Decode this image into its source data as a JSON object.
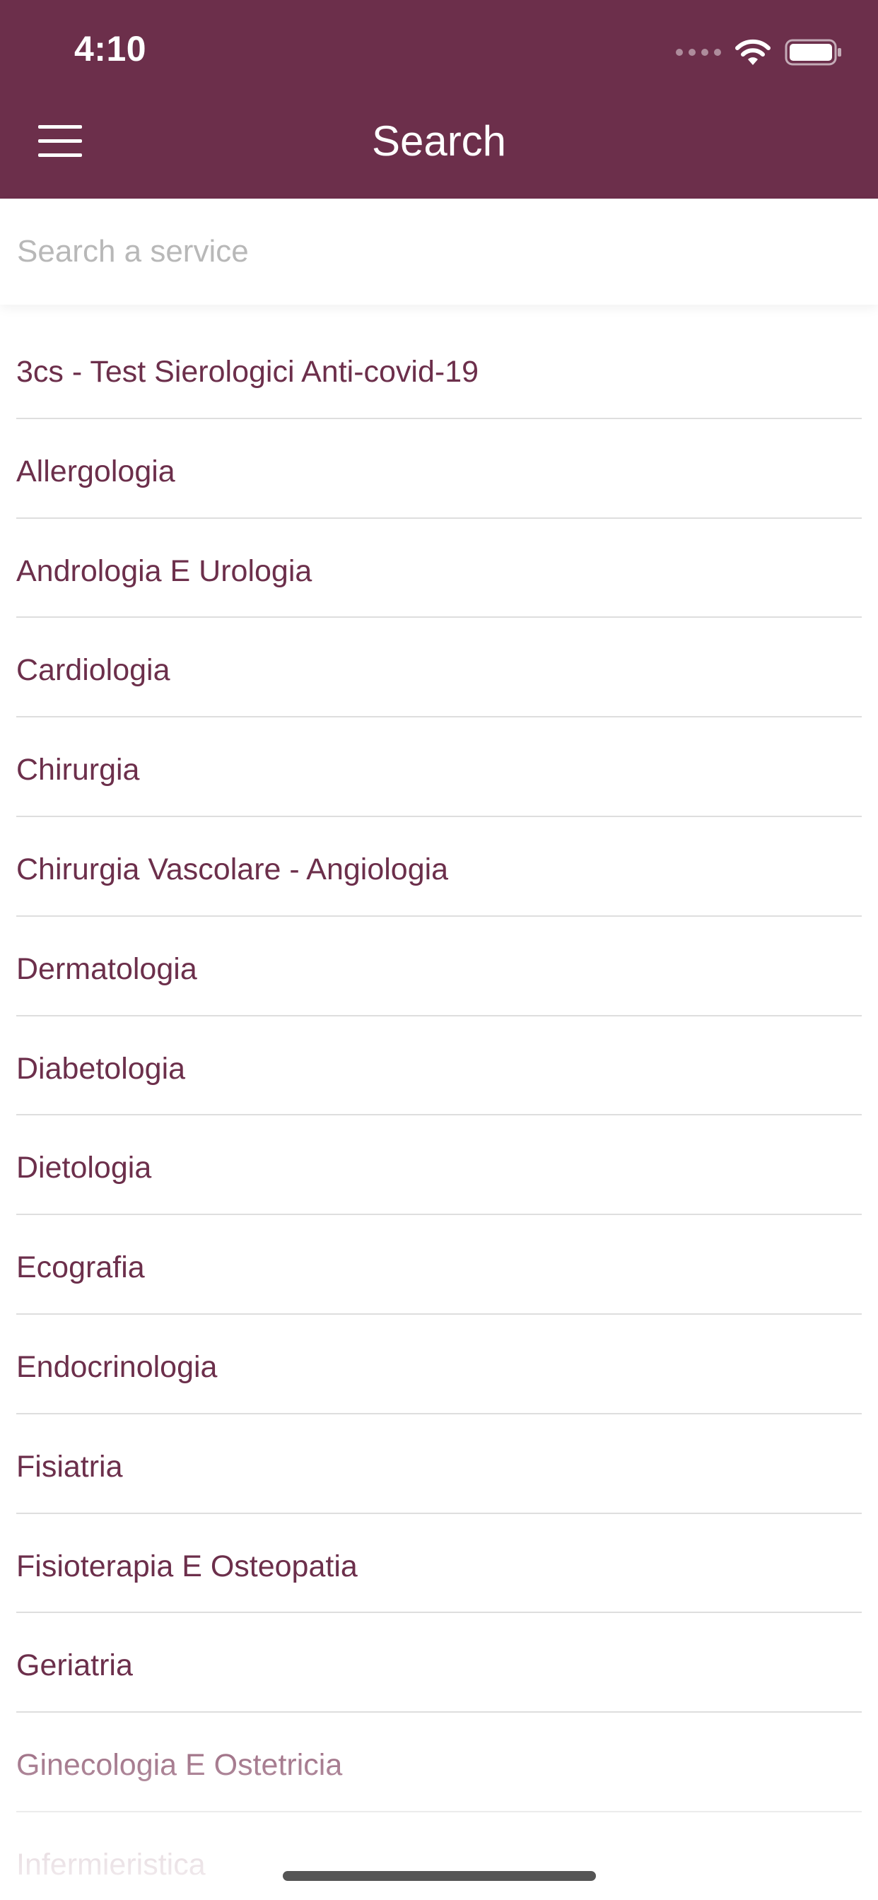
{
  "status_bar": {
    "time": "4:10",
    "wifi_icon": "wifi-icon",
    "battery_icon": "battery-icon",
    "signal_icon": "signal-dots-icon"
  },
  "nav": {
    "title": "Search",
    "menu_icon": "hamburger-menu-icon"
  },
  "search": {
    "placeholder": "Search a service",
    "value": ""
  },
  "services": [
    "3cs - Test Sierologici Anti-covid-19",
    "Allergologia",
    "Andrologia E Urologia",
    "Cardiologia",
    "Chirurgia",
    "Chirurgia Vascolare - Angiologia",
    "Dermatologia",
    "Diabetologia",
    "Dietologia",
    "Ecografia",
    "Endocrinologia",
    "Fisiatria",
    "Fisioterapia E Osteopatia",
    "Geriatria",
    "Ginecologia E Ostetricia",
    "Infermieristica"
  ],
  "colors": {
    "brand": "#6c2f4b",
    "divider": "#dedede",
    "placeholder": "#b8b8b8",
    "background": "#ffffff"
  }
}
